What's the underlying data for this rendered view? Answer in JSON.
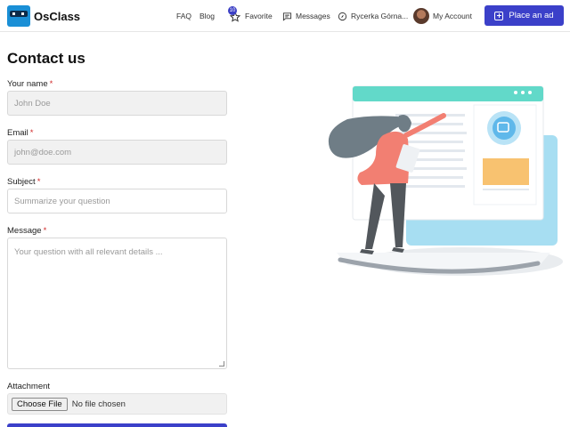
{
  "header": {
    "logo_text": "OsClass",
    "nav": {
      "faq": "FAQ",
      "blog": "Blog",
      "favorite": "Favorite",
      "favorite_count": "10",
      "messages": "Messages",
      "user": "Rycerka Górna...",
      "account": "My Account"
    },
    "place_ad": "Place an ad"
  },
  "form": {
    "title": "Contact us",
    "name_label": "Your name",
    "name_value": "John Doe",
    "email_label": "Email",
    "email_value": "john@doe.com",
    "subject_label": "Subject",
    "subject_placeholder": "Summarize your question",
    "message_label": "Message",
    "message_placeholder": "Your question with all relevant details ...",
    "attachment_label": "Attachment",
    "choose_file": "Choose File",
    "no_file": "No file chosen",
    "required_mark": "*"
  },
  "colors": {
    "accent": "#3b40c9",
    "required": "#d12b2b",
    "illustration_teal": "#62d9c9",
    "illustration_coral": "#f27f72"
  }
}
